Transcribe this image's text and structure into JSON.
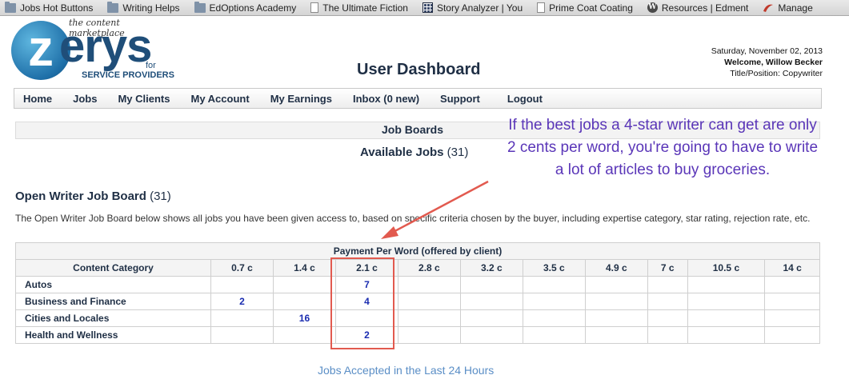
{
  "bookmarks": [
    {
      "label": "Jobs Hot Buttons",
      "icon": "folder-icon"
    },
    {
      "label": "Writing Helps",
      "icon": "folder-icon"
    },
    {
      "label": "EdOptions Academy",
      "icon": "folder-icon"
    },
    {
      "label": "The Ultimate Fiction",
      "icon": "page-icon"
    },
    {
      "label": "Story Analyzer | You",
      "icon": "grid-icon"
    },
    {
      "label": "Prime Coat Coating",
      "icon": "page-icon"
    },
    {
      "label": "Resources | Edment",
      "icon": "wordpress-icon"
    },
    {
      "label": "Manage",
      "icon": "swoosh-icon"
    }
  ],
  "logo": {
    "tagline": "the content marketplace",
    "z": "z",
    "word": "erys",
    "for": "for",
    "subtitle": "SERVICE PROVIDERS"
  },
  "header": {
    "title": "User Dashboard",
    "date": "Saturday, November 02, 2013",
    "welcome": "Welcome, Willow Becker",
    "position": "Title/Position: Copywriter"
  },
  "nav": [
    "Home",
    "Jobs",
    "My Clients",
    "My Account",
    "My Earnings",
    "Inbox (0 new)",
    "Support",
    "Logout"
  ],
  "job_boards": {
    "title": "Job Boards",
    "available_label": "Available Jobs",
    "available_count": "(31)"
  },
  "annotation": "If the best jobs a 4-star writer can get are only 2 cents per word, you're going to have to write a lot of articles to buy groceries.",
  "open_board": {
    "title": "Open Writer Job Board",
    "count": "(31)",
    "description": "The Open Writer Job Board below shows all jobs you have been given access to, based on specific criteria chosen by the buyer, including expertise category, star rating, rejection rate, etc."
  },
  "table": {
    "payment_header": "Payment Per Word (offered by client)",
    "category_header": "Content Category",
    "rates": [
      "0.7 c",
      "1.4 c",
      "2.1 c",
      "2.8 c",
      "3.2 c",
      "3.5 c",
      "4.9 c",
      "7 c",
      "10.5 c",
      "14 c"
    ],
    "rows": [
      {
        "category": "Autos",
        "cells": [
          "",
          "",
          "7",
          "",
          "",
          "",
          "",
          "",
          "",
          ""
        ]
      },
      {
        "category": "Business and Finance",
        "cells": [
          "2",
          "",
          "4",
          "",
          "",
          "",
          "",
          "",
          "",
          ""
        ]
      },
      {
        "category": "Cities and Locales",
        "cells": [
          "",
          "16",
          "",
          "",
          "",
          "",
          "",
          "",
          "",
          ""
        ]
      },
      {
        "category": "Health and Wellness",
        "cells": [
          "",
          "",
          "2",
          "",
          "",
          "",
          "",
          "",
          "",
          ""
        ]
      }
    ]
  },
  "footer_link": "Jobs Accepted in the Last 24 Hours",
  "colors": {
    "accent": "#1f2f45",
    "annotation": "#5a36b8",
    "highlight": "#e25a4f",
    "link": "#5a8ec6",
    "job_count": "#1a2cb0"
  }
}
